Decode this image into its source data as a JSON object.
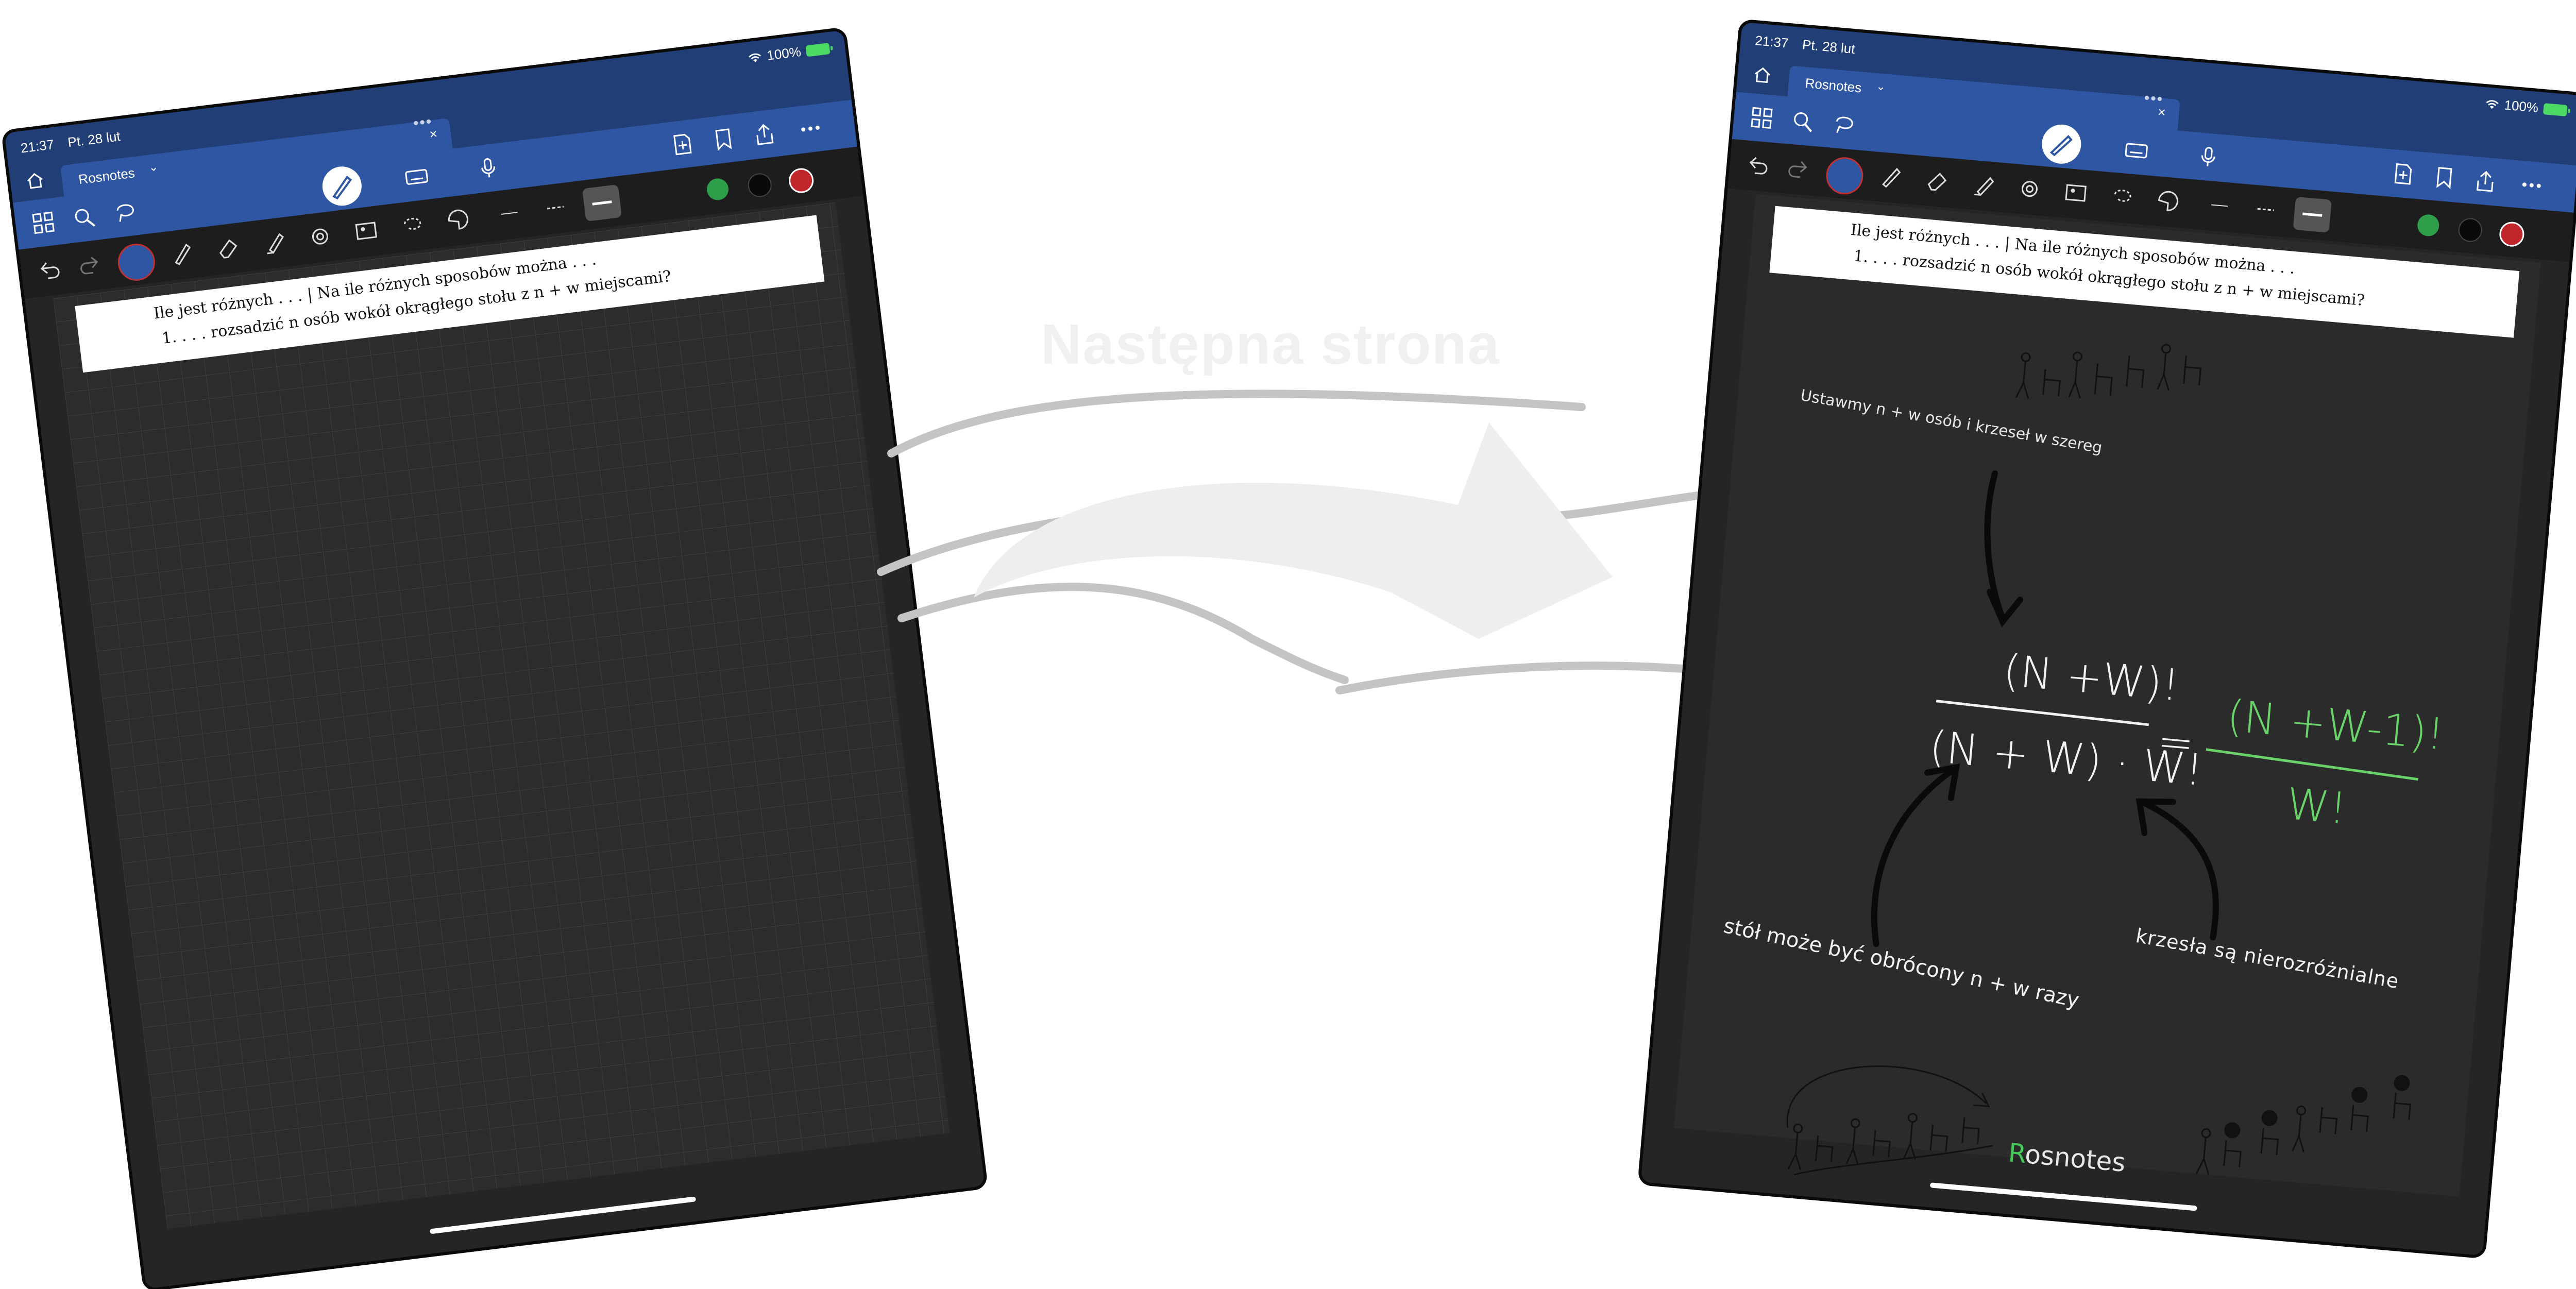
{
  "status_bar": {
    "time": "21:37",
    "date": "Pt. 28 lut",
    "battery": "100%"
  },
  "tab": {
    "label": "Rosnotes"
  },
  "question": {
    "line1": "Ile jest różnych . . . | Na ile różnych sposobów można . . .",
    "line2": "1.  . . . rozsadzić n osób wokół okrągłego stołu z n + w miejscami?"
  },
  "transition": {
    "title": "Następna strona"
  },
  "notes": {
    "step1": "Ustawmy n + w osób i krzeseł w szereg",
    "numerator": "(N +W)!",
    "denominator": "(N + W) · W!",
    "equals": "=",
    "result_numerator": "(N +W-1)!",
    "result_denominator": "W!",
    "chairs_note": "krzesła są nierozróżnialne",
    "rotation_note": "stół może być obrócony n + w razy"
  },
  "brand": {
    "first": "R",
    "rest": "osnotes"
  },
  "colors": {
    "app_blue": "#213e77",
    "toolbar_blue": "#2f56a3",
    "paper_dark": "#2c2c2c",
    "accent_green": "#6ad36a",
    "swatch_green": "#2e9e4a",
    "swatch_black": "#0a0a0a",
    "swatch_red": "#c0262c"
  }
}
